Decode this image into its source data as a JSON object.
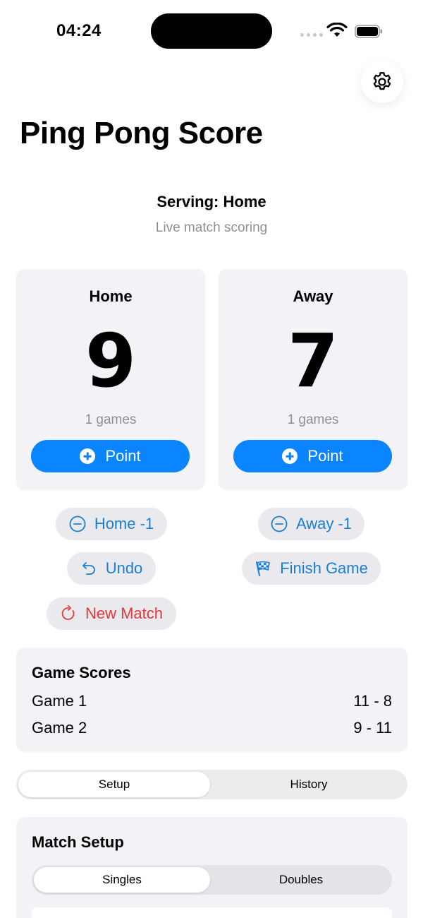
{
  "status_bar": {
    "time": "04:24"
  },
  "header": {
    "title": "Ping Pong Score"
  },
  "serving": {
    "label": "Serving: Home",
    "subtitle": "Live match scoring"
  },
  "teams": [
    {
      "name": "Home",
      "score": "9",
      "games": "1 games",
      "point_label": "Point"
    },
    {
      "name": "Away",
      "score": "7",
      "games": "1 games",
      "point_label": "Point"
    }
  ],
  "actions": {
    "home_minus": "Home -1",
    "away_minus": "Away -1",
    "undo": "Undo",
    "finish_game": "Finish Game",
    "new_match": "New Match"
  },
  "game_scores": {
    "title": "Game Scores",
    "rows": [
      {
        "label": "Game 1",
        "score": "11 - 8"
      },
      {
        "label": "Game 2",
        "score": "9 - 11"
      }
    ]
  },
  "tabs": {
    "setup": "Setup",
    "history": "History",
    "selected": "Setup"
  },
  "match_setup": {
    "title": "Match Setup",
    "mode_singles": "Singles",
    "mode_doubles": "Doubles",
    "selected_mode": "Singles"
  },
  "colors": {
    "accent": "#0a84ff",
    "destructive": "#e5393b",
    "card": "#f2f2f7"
  },
  "icons": [
    "gear-icon",
    "plus-circle-icon",
    "minus-circle-icon",
    "undo-icon",
    "checkered-flag-icon",
    "refresh-icon"
  ]
}
